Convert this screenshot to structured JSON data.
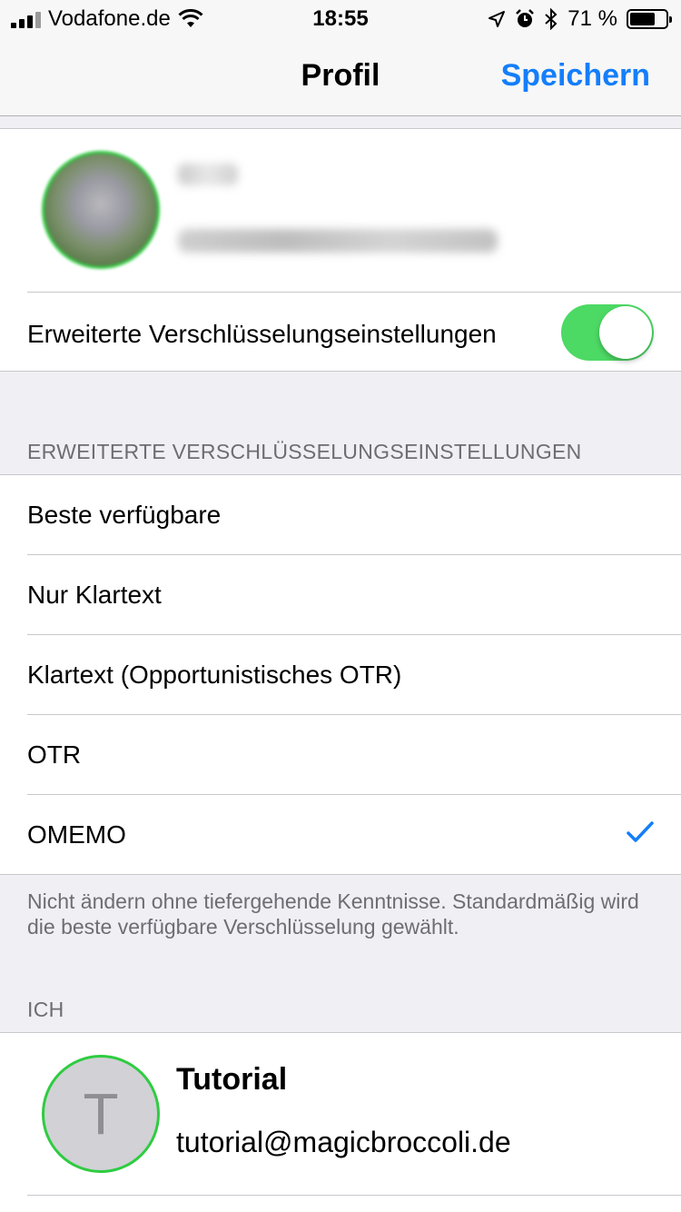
{
  "status_bar": {
    "carrier": "Vodafone.de",
    "time": "18:55",
    "battery_percent": "71 %",
    "battery_level": 0.71,
    "icons": [
      "signal-icon",
      "wifi-icon",
      "location-icon",
      "alarm-icon",
      "bluetooth-icon",
      "battery-icon"
    ]
  },
  "nav": {
    "title": "Profil",
    "save_label": "Speichern",
    "accent_color": "#147efb"
  },
  "profile": {
    "name_redacted": true,
    "jid_redacted": true,
    "encryption_toggle_label": "Erweiterte Verschlüsselungseinstellungen",
    "encryption_toggle_on": true,
    "toggle_color": "#4cd964"
  },
  "encryption": {
    "header": "ERWEITERTE VERSCHLÜSSELUNGSEINSTELLUNGEN",
    "options": [
      {
        "label": "Beste verfügbare",
        "selected": false
      },
      {
        "label": "Nur Klartext",
        "selected": false
      },
      {
        "label": "Klartext (Opportunistisches OTR)",
        "selected": false
      },
      {
        "label": "OTR",
        "selected": false
      },
      {
        "label": "OMEMO",
        "selected": true
      }
    ],
    "footer": "Nicht ändern ohne tiefergehende Kenntnisse. Standardmäßig wird die beste verfügbare Verschlüsselung gewählt."
  },
  "me": {
    "header": "ICH",
    "avatar_letter": "T",
    "name": "Tutorial",
    "jid": "tutorial@magicbroccoli.de"
  }
}
